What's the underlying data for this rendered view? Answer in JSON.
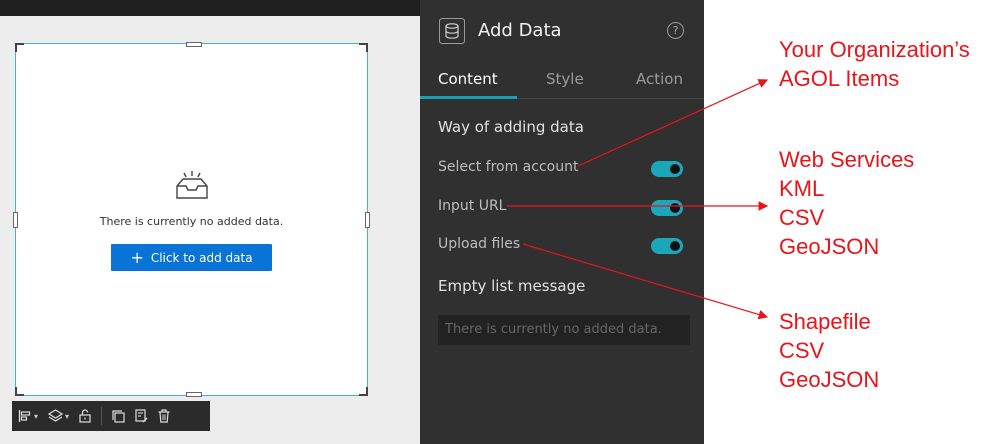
{
  "canvas": {
    "empty_message": "There is currently no added data.",
    "add_button_label": "Click to add data",
    "add_button_icon": "plus-icon",
    "toolbar_icons": [
      "align-icon",
      "layers-icon",
      "lock-icon",
      "duplicate-icon",
      "copy-style-icon",
      "delete-icon"
    ]
  },
  "panel": {
    "title": "Add Data",
    "title_icon": "database-icon",
    "help_icon": "help-icon",
    "tabs": [
      {
        "label": "Content",
        "active": true
      },
      {
        "label": "Style",
        "active": false
      },
      {
        "label": "Action",
        "active": false
      }
    ],
    "section_way": "Way of adding data",
    "options": [
      {
        "label": "Select from account",
        "enabled": true
      },
      {
        "label": "Input URL",
        "enabled": true
      },
      {
        "label": "Upload files",
        "enabled": true
      }
    ],
    "section_empty": "Empty list message",
    "empty_placeholder": "There is currently no added data."
  },
  "annotations": {
    "account": [
      "Your Organization’s",
      "AGOL Items"
    ],
    "url": [
      "Web Services",
      "KML",
      "CSV",
      "GeoJSON"
    ],
    "files": [
      "Shapefile",
      "CSV",
      "GeoJSON"
    ]
  },
  "colors": {
    "accent": "#16a1b4",
    "button_blue": "#0a74d6",
    "annotation_red": "#e8141b",
    "panel_bg": "#303030"
  }
}
